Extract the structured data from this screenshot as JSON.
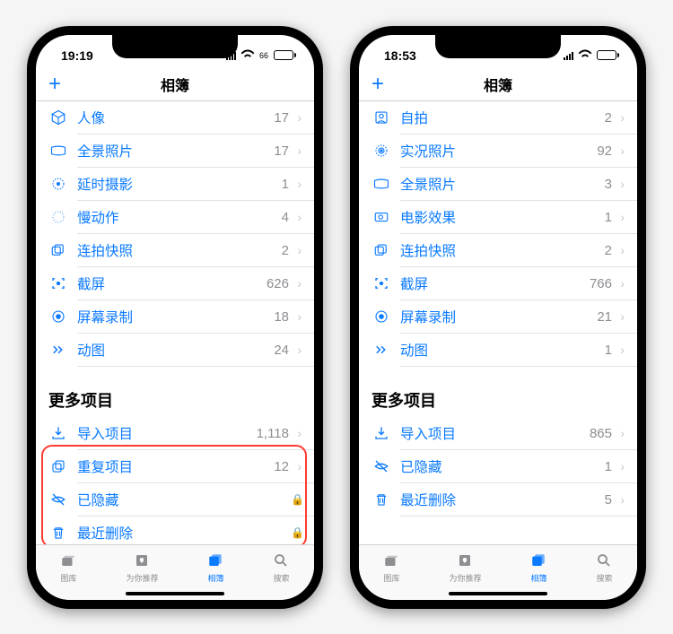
{
  "phones": [
    {
      "time": "19:19",
      "battery": "66",
      "title": "相簿",
      "sectionHeader": "更多项目",
      "highlightStart": 9,
      "highlightEnd": 11,
      "rows": [
        {
          "icon": "cube",
          "label": "人像",
          "count": "17",
          "suffix": "chev"
        },
        {
          "icon": "pano",
          "label": "全景照片",
          "count": "17",
          "suffix": "chev"
        },
        {
          "icon": "timelapse",
          "label": "延时摄影",
          "count": "1",
          "suffix": "chev"
        },
        {
          "icon": "slomo",
          "label": "慢动作",
          "count": "4",
          "suffix": "chev"
        },
        {
          "icon": "burst",
          "label": "连拍快照",
          "count": "2",
          "suffix": "chev"
        },
        {
          "icon": "screenshot",
          "label": "截屏",
          "count": "626",
          "suffix": "chev"
        },
        {
          "icon": "record",
          "label": "屏幕录制",
          "count": "18",
          "suffix": "chev"
        },
        {
          "icon": "gif",
          "label": "动图",
          "count": "24",
          "suffix": "chev"
        },
        {
          "section": true
        },
        {
          "icon": "import",
          "label": "导入项目",
          "count": "1,118",
          "suffix": "chev"
        },
        {
          "icon": "duplicate",
          "label": "重复项目",
          "count": "12",
          "suffix": "chev"
        },
        {
          "icon": "hidden",
          "label": "已隐藏",
          "count": "",
          "suffix": "lock"
        },
        {
          "icon": "trash",
          "label": "最近删除",
          "count": "",
          "suffix": "lock"
        }
      ],
      "tabs": [
        {
          "icon": "library",
          "label": "图库"
        },
        {
          "icon": "foryou",
          "label": "为你推荐"
        },
        {
          "icon": "albums",
          "label": "相簿",
          "active": true
        },
        {
          "icon": "search",
          "label": "搜索"
        }
      ]
    },
    {
      "time": "18:53",
      "battery": "",
      "title": "相簿",
      "sectionHeader": "更多项目",
      "highlightStart": -1,
      "highlightEnd": -1,
      "rows": [
        {
          "icon": "selfie",
          "label": "自拍",
          "count": "2",
          "suffix": "chev"
        },
        {
          "icon": "live",
          "label": "实况照片",
          "count": "92",
          "suffix": "chev"
        },
        {
          "icon": "pano",
          "label": "全景照片",
          "count": "3",
          "suffix": "chev"
        },
        {
          "icon": "cinematic",
          "label": "电影效果",
          "count": "1",
          "suffix": "chev"
        },
        {
          "icon": "burst",
          "label": "连拍快照",
          "count": "2",
          "suffix": "chev"
        },
        {
          "icon": "screenshot",
          "label": "截屏",
          "count": "766",
          "suffix": "chev"
        },
        {
          "icon": "record",
          "label": "屏幕录制",
          "count": "21",
          "suffix": "chev"
        },
        {
          "icon": "gif",
          "label": "动图",
          "count": "1",
          "suffix": "chev"
        },
        {
          "section": true
        },
        {
          "icon": "import",
          "label": "导入项目",
          "count": "865",
          "suffix": "chev"
        },
        {
          "icon": "hidden",
          "label": "已隐藏",
          "count": "1",
          "suffix": "chev"
        },
        {
          "icon": "trash",
          "label": "最近删除",
          "count": "5",
          "suffix": "chev"
        }
      ],
      "tabs": [
        {
          "icon": "library",
          "label": "图库"
        },
        {
          "icon": "foryou",
          "label": "为你推荐"
        },
        {
          "icon": "albums",
          "label": "相簿",
          "active": true
        },
        {
          "icon": "search",
          "label": "搜索"
        }
      ]
    }
  ]
}
